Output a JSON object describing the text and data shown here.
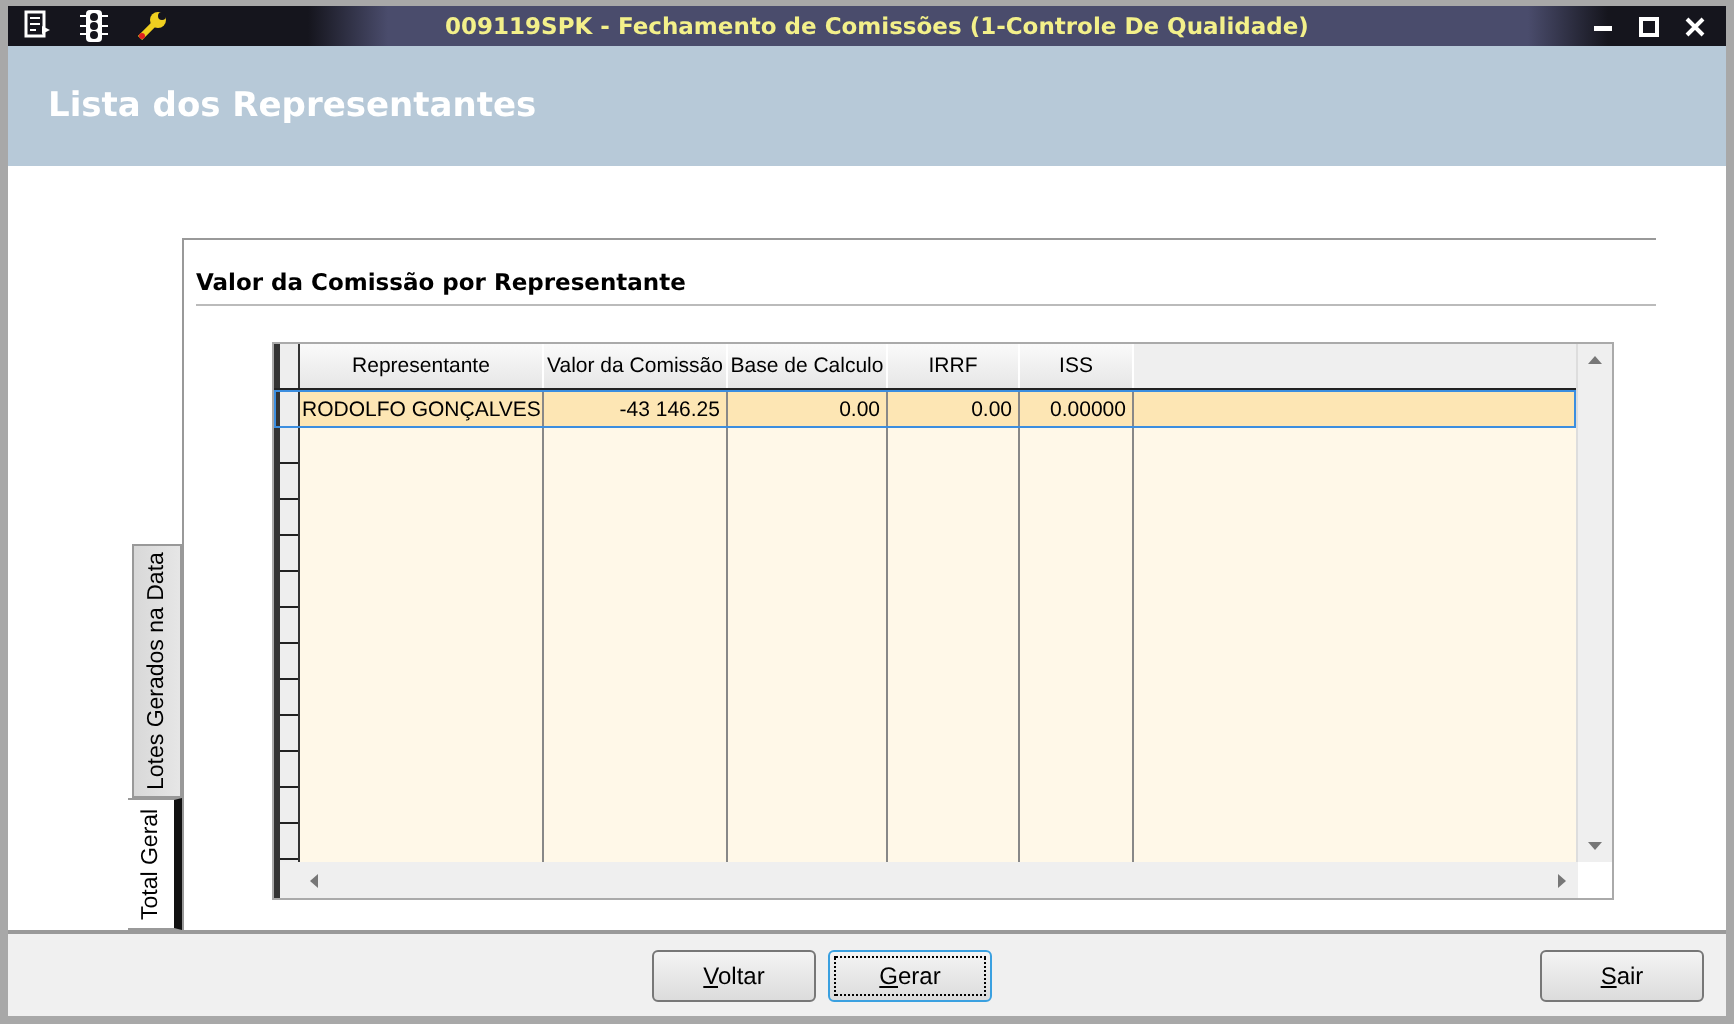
{
  "window": {
    "title": "009119SPK - Fechamento de Comissões (1-Controle De Qualidade)"
  },
  "header": {
    "title": "Lista dos Representantes"
  },
  "tabs": [
    {
      "label": "Lotes Gerados na Data",
      "selected": false
    },
    {
      "label": "Total Geral",
      "selected": true
    }
  ],
  "section": {
    "title": "Valor da Comissão por Representante"
  },
  "table": {
    "columns": [
      "Representante",
      "Valor da Comissão",
      "Base de Calculo",
      "IRRF",
      "ISS"
    ],
    "rows": [
      {
        "cells": [
          "RODOLFO GONÇALVES",
          "-43 146.25",
          "0.00",
          "0.00",
          "0.00000"
        ],
        "selected": true
      }
    ]
  },
  "buttons": [
    {
      "label": "Voltar",
      "focused": false
    },
    {
      "label": "Gerar",
      "focused": true
    },
    {
      "label": "Sair",
      "focused": false
    }
  ]
}
